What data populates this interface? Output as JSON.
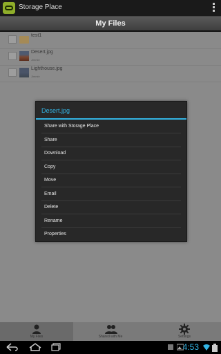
{
  "app": {
    "title": "Storage Place"
  },
  "header": {
    "title": "My Files"
  },
  "files": [
    {
      "name": "test1",
      "meta": "",
      "kind": "folder"
    },
    {
      "name": "Desert.jpg",
      "meta": "Jimmie",
      "kind": "image"
    },
    {
      "name": "Lighthouse.jpg",
      "meta": "Jimmie",
      "kind": "image"
    }
  ],
  "dialog": {
    "title": "Desert.jpg",
    "items": [
      "Share with Storage Place",
      "Share",
      "Download",
      "Copy",
      "Move",
      "Email",
      "Delete",
      "Rename",
      "Properties"
    ]
  },
  "tabs": [
    {
      "label": "My Files",
      "icon": "person-icon"
    },
    {
      "label": "Shared with Me",
      "icon": "people-icon"
    },
    {
      "label": "Settings",
      "icon": "gear-icon"
    }
  ],
  "status": {
    "time": "4:53"
  },
  "colors": {
    "accent": "#33b5e5",
    "app_icon": "#8fae2a"
  }
}
